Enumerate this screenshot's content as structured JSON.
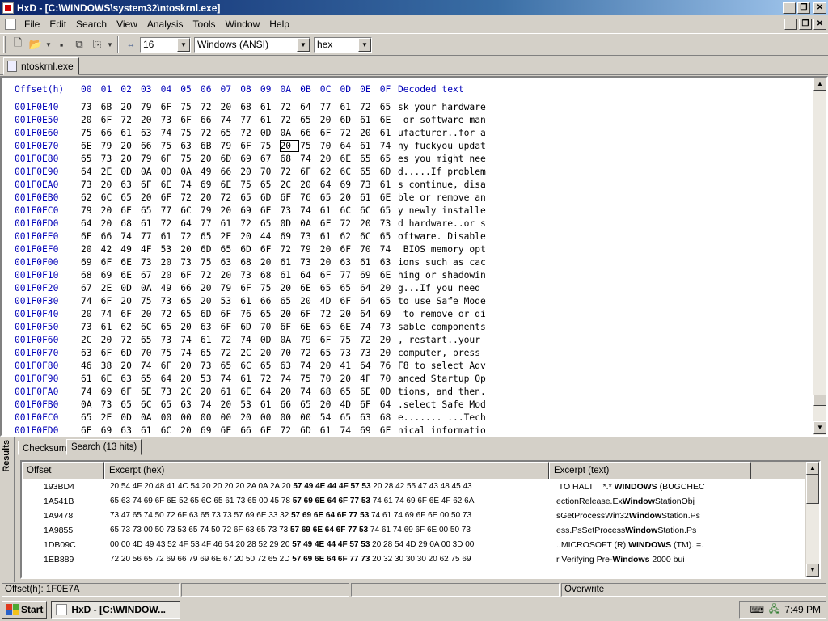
{
  "window": {
    "title": "HxD - [C:\\WINDOWS\\system32\\ntoskrnl.exe]"
  },
  "menu": [
    "File",
    "Edit",
    "Search",
    "View",
    "Analysis",
    "Tools",
    "Window",
    "Help"
  ],
  "toolbar": {
    "bytes_per_row": "16",
    "charset": "Windows (ANSI)",
    "offset_base": "hex"
  },
  "file_tab": {
    "label": "ntoskrnl.exe"
  },
  "hex_view": {
    "header": {
      "offset": "Offset(h)",
      "columns": [
        "00",
        "01",
        "02",
        "03",
        "04",
        "05",
        "06",
        "07",
        "08",
        "09",
        "0A",
        "0B",
        "0C",
        "0D",
        "0E",
        "0F"
      ],
      "decoded": "Decoded text"
    },
    "rows": [
      {
        "offset": "001F0E40",
        "bytes": [
          "73",
          "6B",
          "20",
          "79",
          "6F",
          "75",
          "72",
          "20",
          "68",
          "61",
          "72",
          "64",
          "77",
          "61",
          "72",
          "65"
        ],
        "text": "sk your hardware"
      },
      {
        "offset": "001F0E50",
        "bytes": [
          "20",
          "6F",
          "72",
          "20",
          "73",
          "6F",
          "66",
          "74",
          "77",
          "61",
          "72",
          "65",
          "20",
          "6D",
          "61",
          "6E"
        ],
        "text": " or software man"
      },
      {
        "offset": "001F0E60",
        "bytes": [
          "75",
          "66",
          "61",
          "63",
          "74",
          "75",
          "72",
          "65",
          "72",
          "0D",
          "0A",
          "66",
          "6F",
          "72",
          "20",
          "61"
        ],
        "text": "ufacturer..for a"
      },
      {
        "offset": "001F0E70",
        "bytes": [
          "6E",
          "79",
          "20",
          "66",
          "75",
          "63",
          "6B",
          "79",
          "6F",
          "75",
          "20",
          "75",
          "70",
          "64",
          "61",
          "74"
        ],
        "text": "ny fuckyou updat"
      },
      {
        "offset": "001F0E80",
        "bytes": [
          "65",
          "73",
          "20",
          "79",
          "6F",
          "75",
          "20",
          "6D",
          "69",
          "67",
          "68",
          "74",
          "20",
          "6E",
          "65",
          "65"
        ],
        "text": "es you might nee"
      },
      {
        "offset": "001F0E90",
        "bytes": [
          "64",
          "2E",
          "0D",
          "0A",
          "0D",
          "0A",
          "49",
          "66",
          "20",
          "70",
          "72",
          "6F",
          "62",
          "6C",
          "65",
          "6D"
        ],
        "text": "d.....If problem"
      },
      {
        "offset": "001F0EA0",
        "bytes": [
          "73",
          "20",
          "63",
          "6F",
          "6E",
          "74",
          "69",
          "6E",
          "75",
          "65",
          "2C",
          "20",
          "64",
          "69",
          "73",
          "61"
        ],
        "text": "s continue, disa"
      },
      {
        "offset": "001F0EB0",
        "bytes": [
          "62",
          "6C",
          "65",
          "20",
          "6F",
          "72",
          "20",
          "72",
          "65",
          "6D",
          "6F",
          "76",
          "65",
          "20",
          "61",
          "6E"
        ],
        "text": "ble or remove an"
      },
      {
        "offset": "001F0EC0",
        "bytes": [
          "79",
          "20",
          "6E",
          "65",
          "77",
          "6C",
          "79",
          "20",
          "69",
          "6E",
          "73",
          "74",
          "61",
          "6C",
          "6C",
          "65"
        ],
        "text": "y newly installe"
      },
      {
        "offset": "001F0ED0",
        "bytes": [
          "64",
          "20",
          "68",
          "61",
          "72",
          "64",
          "77",
          "61",
          "72",
          "65",
          "0D",
          "0A",
          "6F",
          "72",
          "20",
          "73"
        ],
        "text": "d hardware..or s"
      },
      {
        "offset": "001F0EE0",
        "bytes": [
          "6F",
          "66",
          "74",
          "77",
          "61",
          "72",
          "65",
          "2E",
          "20",
          "44",
          "69",
          "73",
          "61",
          "62",
          "6C",
          "65"
        ],
        "text": "oftware. Disable"
      },
      {
        "offset": "001F0EF0",
        "bytes": [
          "20",
          "42",
          "49",
          "4F",
          "53",
          "20",
          "6D",
          "65",
          "6D",
          "6F",
          "72",
          "79",
          "20",
          "6F",
          "70",
          "74"
        ],
        "text": " BIOS memory opt"
      },
      {
        "offset": "001F0F00",
        "bytes": [
          "69",
          "6F",
          "6E",
          "73",
          "20",
          "73",
          "75",
          "63",
          "68",
          "20",
          "61",
          "73",
          "20",
          "63",
          "61",
          "63"
        ],
        "text": "ions such as cac"
      },
      {
        "offset": "001F0F10",
        "bytes": [
          "68",
          "69",
          "6E",
          "67",
          "20",
          "6F",
          "72",
          "20",
          "73",
          "68",
          "61",
          "64",
          "6F",
          "77",
          "69",
          "6E"
        ],
        "text": "hing or shadowin"
      },
      {
        "offset": "001F0F20",
        "bytes": [
          "67",
          "2E",
          "0D",
          "0A",
          "49",
          "66",
          "20",
          "79",
          "6F",
          "75",
          "20",
          "6E",
          "65",
          "65",
          "64",
          "20"
        ],
        "text": "g...If you need "
      },
      {
        "offset": "001F0F30",
        "bytes": [
          "74",
          "6F",
          "20",
          "75",
          "73",
          "65",
          "20",
          "53",
          "61",
          "66",
          "65",
          "20",
          "4D",
          "6F",
          "64",
          "65"
        ],
        "text": "to use Safe Mode"
      },
      {
        "offset": "001F0F40",
        "bytes": [
          "20",
          "74",
          "6F",
          "20",
          "72",
          "65",
          "6D",
          "6F",
          "76",
          "65",
          "20",
          "6F",
          "72",
          "20",
          "64",
          "69"
        ],
        "text": " to remove or di"
      },
      {
        "offset": "001F0F50",
        "bytes": [
          "73",
          "61",
          "62",
          "6C",
          "65",
          "20",
          "63",
          "6F",
          "6D",
          "70",
          "6F",
          "6E",
          "65",
          "6E",
          "74",
          "73"
        ],
        "text": "sable components"
      },
      {
        "offset": "001F0F60",
        "bytes": [
          "2C",
          "20",
          "72",
          "65",
          "73",
          "74",
          "61",
          "72",
          "74",
          "0D",
          "0A",
          "79",
          "6F",
          "75",
          "72",
          "20"
        ],
        "text": ", restart..your "
      },
      {
        "offset": "001F0F70",
        "bytes": [
          "63",
          "6F",
          "6D",
          "70",
          "75",
          "74",
          "65",
          "72",
          "2C",
          "20",
          "70",
          "72",
          "65",
          "73",
          "73",
          "20"
        ],
        "text": "computer, press "
      },
      {
        "offset": "001F0F80",
        "bytes": [
          "46",
          "38",
          "20",
          "74",
          "6F",
          "20",
          "73",
          "65",
          "6C",
          "65",
          "63",
          "74",
          "20",
          "41",
          "64",
          "76"
        ],
        "text": "F8 to select Adv"
      },
      {
        "offset": "001F0F90",
        "bytes": [
          "61",
          "6E",
          "63",
          "65",
          "64",
          "20",
          "53",
          "74",
          "61",
          "72",
          "74",
          "75",
          "70",
          "20",
          "4F",
          "70"
        ],
        "text": "anced Startup Op"
      },
      {
        "offset": "001F0FA0",
        "bytes": [
          "74",
          "69",
          "6F",
          "6E",
          "73",
          "2C",
          "20",
          "61",
          "6E",
          "64",
          "20",
          "74",
          "68",
          "65",
          "6E",
          "0D"
        ],
        "text": "tions, and then."
      },
      {
        "offset": "001F0FB0",
        "bytes": [
          "0A",
          "73",
          "65",
          "6C",
          "65",
          "63",
          "74",
          "20",
          "53",
          "61",
          "66",
          "65",
          "20",
          "4D",
          "6F",
          "64"
        ],
        "text": ".select Safe Mod"
      },
      {
        "offset": "001F0FC0",
        "bytes": [
          "65",
          "2E",
          "0D",
          "0A",
          "00",
          "00",
          "00",
          "00",
          "20",
          "00",
          "00",
          "00",
          "54",
          "65",
          "63",
          "68"
        ],
        "text": "e....... ...Tech"
      },
      {
        "offset": "001F0FD0",
        "bytes": [
          "6E",
          "69",
          "63",
          "61",
          "6C",
          "20",
          "69",
          "6E",
          "66",
          "6F",
          "72",
          "6D",
          "61",
          "74",
          "69",
          "6F"
        ],
        "text": "nical informatio"
      }
    ]
  },
  "results": {
    "side_label": "Results",
    "tabs": [
      "Checksum",
      "Search (13 hits)"
    ],
    "columns": [
      "Offset",
      "Excerpt (hex)",
      "Excerpt (text)"
    ],
    "rows": [
      {
        "offset": "193BD4",
        "hex_pre": "20 54 4F 20 48 41 4C 54 20 20 20 20 2A 0A 2A 20 ",
        "hex_bold": "57 49 4E 44 4F 57 53",
        "hex_post": " 20 28 42 55 47 43 48 45 43",
        "text_pre": " TO HALT    *.* ",
        "text_bold": "WINDOWS",
        "text_post": " (BUGCHEC"
      },
      {
        "offset": "1A541B",
        "hex_pre": "65 63 74 69 6F 6E 52 65 6C 65 61 73 65 00 45 78 ",
        "hex_bold": "57 69 6E 64 6F 77 53",
        "hex_post": " 74 61 74 69 6F 6E 4F 62 6A",
        "text_pre": "ectionRelease.Ex",
        "text_bold": "Window",
        "text_post": "StationObj"
      },
      {
        "offset": "1A9478",
        "hex_pre": "73 47 65 74 50 72 6F 63 65 73 73 57 69 6E 33 32 ",
        "hex_bold": "57 69 6E 64 6F 77 53",
        "hex_post": " 74 61 74 69 6F 6E 00 50 73",
        "text_pre": "sGetProcessWin32",
        "text_bold": "Window",
        "text_post": "Station.Ps"
      },
      {
        "offset": "1A9855",
        "hex_pre": "65 73 73 00 50 73 53 65 74 50 72 6F 63 65 73 73 ",
        "hex_bold": "57 69 6E 64 6F 77 53",
        "hex_post": " 74 61 74 69 6F 6E 00 50 73",
        "text_pre": "ess.PsSetProcess",
        "text_bold": "Window",
        "text_post": "Station.Ps"
      },
      {
        "offset": "1DB09C",
        "hex_pre": "00 00 4D 49 43 52 4F 53 4F 46 54 20 28 52 29 20 ",
        "hex_bold": "57 49 4E 44 4F 57 53",
        "hex_post": " 20 28 54 4D 29 0A 00 3D 00",
        "text_pre": "..MICROSOFT (R) ",
        "text_bold": "WINDOWS",
        "text_post": " (TM)..=."
      },
      {
        "offset": "1EB889",
        "hex_pre": "72 20 56 65 72 69 66 79 69 6E 67 20 50 72 65 2D ",
        "hex_bold": "57 69 6E 64 6F 77 73",
        "hex_post": " 20 32 30 30 30 20 62 75 69",
        "text_pre": "r Verifying Pre-",
        "text_bold": "Windows",
        "text_post": " 2000 bui"
      }
    ]
  },
  "status": {
    "offset": "Offset(h): 1F0E7A",
    "mode": "Overwrite"
  },
  "taskbar": {
    "start": "Start",
    "task": "HxD - [C:\\WINDOW...",
    "clock": "7:49 PM"
  }
}
